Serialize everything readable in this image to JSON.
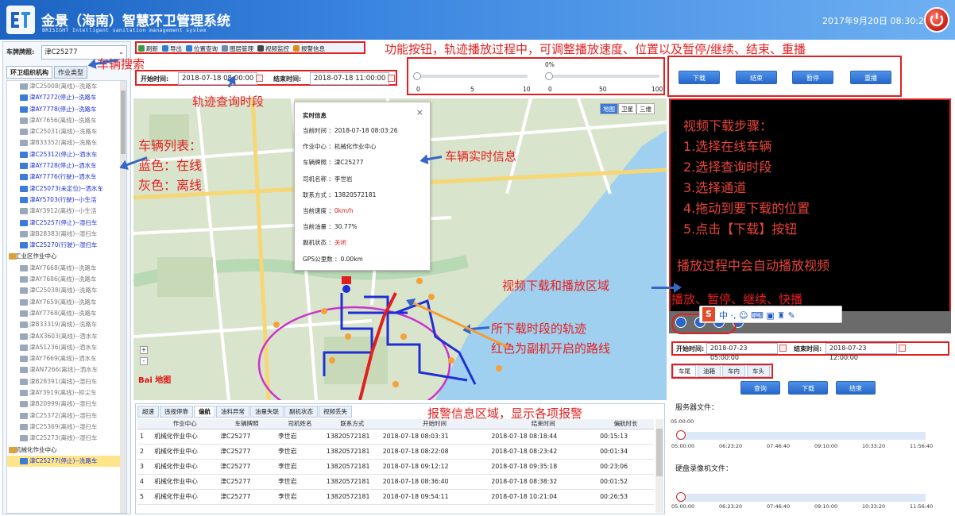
{
  "header": {
    "title": "金景（海南）智慧环卫管理系统",
    "subtitle": "BRISIGHT Intelligent sanitation management system",
    "datetime": "2017年9月20日 08:30:20"
  },
  "sidebar": {
    "search_label": "车牌牌照:",
    "search_value": "津C25277",
    "tabs": [
      "环卫组织机构",
      "作业类型"
    ],
    "vehicles": [
      {
        "text": "津C25008(离线)--洗路车",
        "status": "off"
      },
      {
        "text": "津AY7272(停止)--洗路车",
        "status": "on"
      },
      {
        "text": "津AY7778(停止)--洗路车",
        "status": "on"
      },
      {
        "text": "津AY7656(离线)--洗路车",
        "status": "off"
      },
      {
        "text": "津C25031(离线)--洗路车",
        "status": "off"
      },
      {
        "text": "津B33352(离线)--洗路车",
        "status": "off"
      },
      {
        "text": "津C25312(停止)--洒水车",
        "status": "on"
      },
      {
        "text": "津AY7728(停止)--洒水车",
        "status": "on"
      },
      {
        "text": "津AY7776(行驶)--洒水车",
        "status": "on"
      },
      {
        "text": "津C25073(未定位)--洒水车",
        "status": "on"
      },
      {
        "text": "津AY5703(行驶)--小生活",
        "status": "on"
      },
      {
        "text": "津AY3912(离线)--小生活",
        "status": "off"
      },
      {
        "text": "津C25257(停止)--湿扫车",
        "status": "on"
      },
      {
        "text": "津B28383(离线)--湿扫车",
        "status": "off"
      },
      {
        "text": "津C25270(行驶)--湿扫车",
        "status": "on"
      },
      {
        "text": "工业区作业中心",
        "status": "group"
      },
      {
        "text": "津AY7668(离线)--洗路车",
        "status": "off"
      },
      {
        "text": "津AY7686(离线)--洗路车",
        "status": "off"
      },
      {
        "text": "津C25038(离线)--洗路车",
        "status": "off"
      },
      {
        "text": "津AY7659(离线)--洗路车",
        "status": "off"
      },
      {
        "text": "津AY7768(离线)--洗路车",
        "status": "off"
      },
      {
        "text": "津B33319(离线)--洗路车",
        "status": "off"
      },
      {
        "text": "津AX3603(离线)--洒水车",
        "status": "off"
      },
      {
        "text": "津AS1236(离线)--洒水车",
        "status": "off"
      },
      {
        "text": "津AY7669(离线)--洒水车",
        "status": "off"
      },
      {
        "text": "津AN7266(离线)--洒水车",
        "status": "off"
      },
      {
        "text": "津B28391(离线)--湿扫车",
        "status": "off"
      },
      {
        "text": "津AY3919(离线)--抑尘车",
        "status": "off"
      },
      {
        "text": "津B20999(离线)--湿扫车",
        "status": "off"
      },
      {
        "text": "津C25372(离线)--湿扫车",
        "status": "off"
      },
      {
        "text": "津C25369(离线)--湿扫车",
        "status": "off"
      },
      {
        "text": "津C25273(离线)--湿扫车",
        "status": "off"
      },
      {
        "text": "机械化作业中心",
        "status": "group"
      },
      {
        "text": "津C25277(停止)--洗路车",
        "status": "sel"
      }
    ]
  },
  "toolbar": {
    "buttons": [
      {
        "label": "刷新",
        "color": "#3c9a3c"
      },
      {
        "label": "导出",
        "color": "#2f7fd1"
      },
      {
        "label": "位置查询",
        "color": "#2f7fd1"
      },
      {
        "label": "图层管理",
        "color": "#6a8ab0"
      },
      {
        "label": "视频监控",
        "color": "#444"
      },
      {
        "label": "报警信息",
        "color": "#e08a1a"
      }
    ]
  },
  "query": {
    "start_label": "开始时间:",
    "start_value": "2018-07-18 08:00:00",
    "end_label": "结束时间:",
    "end_value": "2018-07-18 11:00:00"
  },
  "playback": {
    "speed_ticks": [
      "0",
      "5",
      "10"
    ],
    "progress_percent_label": "0%",
    "progress_ticks": [
      "0",
      "50",
      "100"
    ],
    "buttons": [
      "下载",
      "结束",
      "暂停",
      "重播"
    ]
  },
  "popup": {
    "title": "实时信息",
    "rows": [
      {
        "label": "当前时间",
        "value": "2018-07-18 08:03:26",
        "red": false
      },
      {
        "label": "作业中心",
        "value": "机械化作业中心",
        "red": false
      },
      {
        "label": "车辆牌照",
        "value": "津C25277",
        "red": false
      },
      {
        "label": "司机名称",
        "value": "李世岩",
        "red": false
      },
      {
        "label": "联系方式",
        "value": "13820572181",
        "red": false
      },
      {
        "label": "当前速度",
        "value": "0km/h",
        "red": true
      },
      {
        "label": "当前油量",
        "value": "30.77%",
        "red": false
      },
      {
        "label": "副机状态",
        "value": "关闭",
        "red": true
      },
      {
        "label": "GPS公里数",
        "value": "0.00km",
        "red": false
      }
    ]
  },
  "map": {
    "types": [
      "地图",
      "卫星",
      "三维"
    ],
    "zoom_in": "+",
    "zoom_out": "-",
    "logo": "Bai 地图"
  },
  "alarm": {
    "tabs": [
      "超速",
      "违规停靠",
      "偏航",
      "油料异常",
      "油量失联",
      "副机状态",
      "视频丢失"
    ],
    "active_tab": 2,
    "columns": [
      "",
      "作业中心",
      "车辆牌照",
      "司机姓名",
      "联系方式",
      "开始时间",
      "结束时间",
      "偏航时长"
    ],
    "rows": [
      [
        "1",
        "机械化作业中心",
        "津C25277",
        "李世岩",
        "13820572181",
        "2018-07-18 08:03:31",
        "2018-07-18 08:18:44",
        "00:15:13"
      ],
      [
        "2",
        "机械化作业中心",
        "津C25277",
        "李世岩",
        "13820572181",
        "2018-07-18 08:22:08",
        "2018-07-18 08:23:42",
        "00:01:34"
      ],
      [
        "3",
        "机械化作业中心",
        "津C25277",
        "李世岩",
        "13820572181",
        "2018-07-18 09:12:12",
        "2018-07-18 09:35:18",
        "00:23:06"
      ],
      [
        "4",
        "机械化作业中心",
        "津C25277",
        "李世岩",
        "13820572181",
        "2018-07-18 08:36:40",
        "2018-07-18 08:38:32",
        "00:01:52"
      ],
      [
        "5",
        "机械化作业中心",
        "津C25277",
        "李世岩",
        "13820572181",
        "2018-07-18 09:54:11",
        "2018-07-18 10:21:04",
        "00:26:53"
      ]
    ]
  },
  "video": {
    "steps": [
      "视频下载步骤：",
      "1.选择在线车辆",
      "2.选择查询时段",
      "3.选择通道",
      "4.拖动到要下载的位置",
      "5.点击【下载】按钮",
      "播放过程中会自动播放视频"
    ],
    "controls_note": "播放、暂停、继续、快播"
  },
  "video_query": {
    "start_label": "开始时间:",
    "start_value": "2018-07-23 05:00:00",
    "end_label": "结束时间:",
    "end_value": "2018-07-23 12:00:00",
    "channels": [
      "车尾",
      "油箱",
      "车内",
      "车头"
    ],
    "buttons": [
      "查询",
      "下载",
      "结束"
    ],
    "server_files_label": "服务器文件：",
    "disk_files_label": "硬盘录像机文件：",
    "scale_top": "05:00:00",
    "ticks": [
      "05:00:00",
      "06:23:20",
      "07:46:40",
      "09:10:00",
      "10:33:20",
      "11:56:40"
    ]
  },
  "annotations": {
    "func_buttons": "功能按钮，轨迹播放过程中，可调整播放速度、位置以及暂停/继续、结束、重播",
    "vehicle_search": "车辆搜索",
    "time_query": "轨迹查询时段",
    "vehicle_list_1": "车辆列表：",
    "vehicle_list_2": "蓝色：在线",
    "vehicle_list_3": "灰色：离线",
    "realtime": "车辆实时信息",
    "video_area": "视频下载和播放区域",
    "track_1": "所下载时段的轨迹",
    "track_2": "红色为副机开启的路线",
    "alarm_area": "报警信息区域，显示各项报警"
  },
  "colors": {
    "header_blue": "#1c63c2",
    "annotation_red": "#e62020",
    "online_blue": "#1c2fd0",
    "offline_gray": "#777777"
  }
}
